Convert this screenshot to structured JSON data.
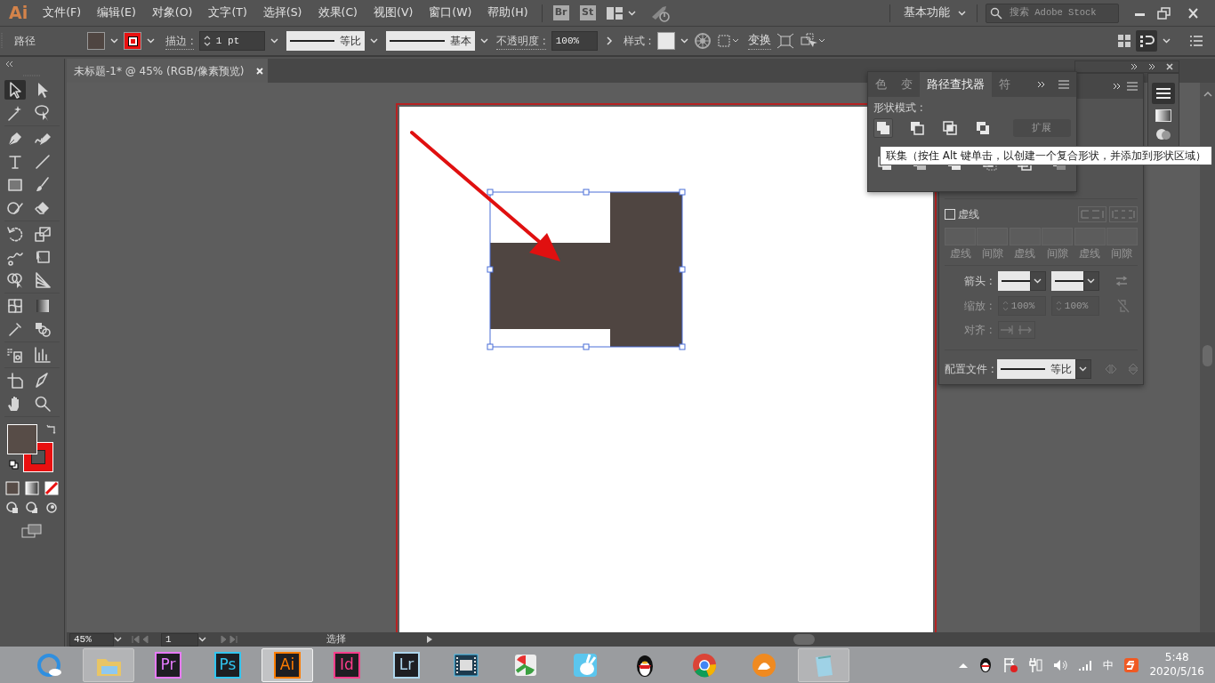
{
  "menu_bar": {
    "logo": "Ai",
    "items": [
      "文件(F)",
      "编辑(E)",
      "对象(O)",
      "文字(T)",
      "选择(S)",
      "效果(C)",
      "视图(V)",
      "窗口(W)",
      "帮助(H)"
    ],
    "bridge": "Br",
    "stock": "St",
    "workspace": "基本功能",
    "search": {
      "placeholder": "搜索 Adobe Stock"
    }
  },
  "control_bar": {
    "selection_type": "路径",
    "stroke_label": "描边 :",
    "stroke_weight": "1 pt",
    "width_profile": "等比",
    "brush": "基本",
    "opacity_label": "不透明度 :",
    "opacity": "100%",
    "style_label": "样式 :",
    "transform": "变换"
  },
  "document_tab": {
    "title": "未标题-1* @ 45% (RGB/像素预览)"
  },
  "pathfinder_panel": {
    "tabs": [
      {
        "label": "色",
        "selected": false
      },
      {
        "label": "变",
        "selected": false
      },
      {
        "label": "路径查找器",
        "selected": true
      },
      {
        "label": "符",
        "selected": false
      }
    ],
    "shape_modes_label": "形状模式 :",
    "expand": {
      "label": "扩展",
      "disabled": true
    }
  },
  "tooltip": {
    "text": "联集（按住 Alt 键单击，以创建一个复合形状，并添加到形状区域）"
  },
  "stroke_panel": {
    "dashed_line": {
      "label": "虚线",
      "checked": false
    },
    "dash_fields": [
      {
        "label": "虚线",
        "disabled": true
      },
      {
        "label": "间隙",
        "disabled": true
      },
      {
        "label": "虚线",
        "disabled": true
      },
      {
        "label": "间隙",
        "disabled": true
      },
      {
        "label": "虚线",
        "disabled": true
      },
      {
        "label": "间隙",
        "disabled": true
      }
    ],
    "arrowheads_label": "箭头 :",
    "scale_label": "缩放 :",
    "scale_start": "100%",
    "scale_end": "100%",
    "align_label": "对齐 :",
    "profile_label": "配置文件 :",
    "profile": "等比"
  },
  "status_bar": {
    "zoom": "45%",
    "artboard": "1",
    "tool": "选择"
  },
  "taskbar": {
    "apps": [
      {
        "kind": "browser",
        "selected": false,
        "running": false
      },
      {
        "kind": "folder",
        "selected": false,
        "running": true
      },
      {
        "kind": "letters",
        "label": "Pr",
        "color": "#e77bff",
        "selected": false,
        "running": false
      },
      {
        "kind": "letters",
        "label": "Ps",
        "color": "#31c5f0",
        "selected": false,
        "running": false
      },
      {
        "kind": "letters",
        "label": "Ai",
        "color": "#ff7c00",
        "selected": true,
        "running": true
      },
      {
        "kind": "letters",
        "label": "Id",
        "color": "#ff3d8b",
        "selected": false,
        "running": false
      },
      {
        "kind": "letters",
        "label": "Lr",
        "color": "#add5ec",
        "selected": false,
        "running": false
      },
      {
        "kind": "film",
        "selected": false,
        "running": false
      },
      {
        "kind": "pinwheel",
        "selected": false,
        "running": false
      },
      {
        "kind": "rabbit",
        "selected": false,
        "running": false
      },
      {
        "kind": "penguin",
        "selected": false,
        "running": false
      },
      {
        "kind": "chrome",
        "selected": false,
        "running": false
      },
      {
        "kind": "cat",
        "selected": false,
        "running": false
      },
      {
        "kind": "notepad",
        "selected": false,
        "running": true
      }
    ],
    "tray": {
      "ime": "中",
      "time": "5:48",
      "date": "2020/5/16"
    }
  }
}
